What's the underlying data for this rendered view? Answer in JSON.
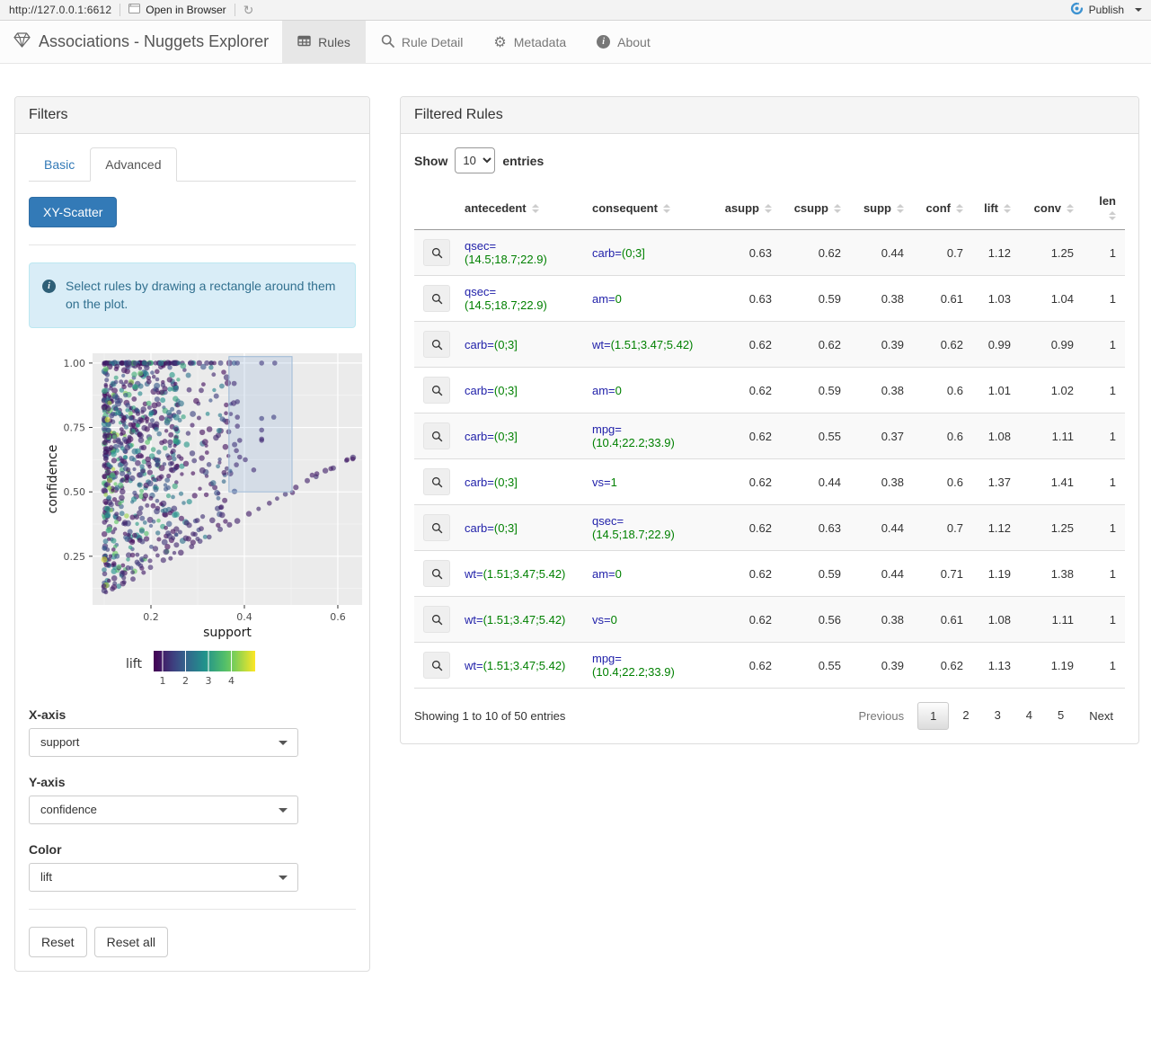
{
  "viewer_bar": {
    "url": "http://127.0.0.1:6612",
    "open_in_browser": "Open in Browser",
    "publish_label": "Publish",
    "publish_color": "#3c92d1"
  },
  "navbar": {
    "brand": "Associations - Nuggets Explorer",
    "tabs": [
      {
        "label": "Rules",
        "icon": "table-icon",
        "active": true
      },
      {
        "label": "Rule Detail",
        "icon": "search-icon",
        "active": false
      },
      {
        "label": "Metadata",
        "icon": "gear-icon",
        "active": false
      },
      {
        "label": "About",
        "icon": "info-icon",
        "active": false
      }
    ]
  },
  "filters": {
    "title": "Filters",
    "tab_basic": "Basic",
    "tab_advanced": "Advanced",
    "scatter_button": "XY-Scatter",
    "alert_text": "Select rules by drawing a rectangle around them on the plot.",
    "xaxis_label": "X-axis",
    "xaxis_value": "support",
    "yaxis_label": "Y-axis",
    "yaxis_value": "confidence",
    "color_label": "Color",
    "color_value": "lift",
    "reset_label": "Reset",
    "reset_all_label": "Reset all"
  },
  "chart_data": {
    "type": "scatter",
    "xlabel": "support",
    "ylabel": "confidence",
    "xlim": [
      0.075,
      0.652
    ],
    "ylim": [
      0.061,
      1.038
    ],
    "xticks": [
      0.2,
      0.4,
      0.6
    ],
    "yticks": [
      0.25,
      0.5,
      0.75,
      1.0
    ],
    "xminor": [
      0.1,
      0.3,
      0.5
    ],
    "yminor": [
      0.125,
      0.375,
      0.625,
      0.875
    ],
    "grid": true,
    "panel_bg": "#ebebeb",
    "color_scale": "viridis",
    "legend": {
      "label": "lift",
      "ticks": [
        "1",
        "2",
        "3",
        "4"
      ],
      "tick_fractions": [
        0.088,
        0.314,
        0.54,
        0.766
      ],
      "position": "bottom"
    },
    "selection_rect": {
      "x0": 0.367,
      "x1": 0.502,
      "y0": 0.5,
      "y1": 1.025
    },
    "points_model": {
      "seed": 7,
      "cloud_main": {
        "n": 720,
        "s_min": 0.1,
        "s_span": 0.16
      },
      "cloud_mid": {
        "n": 130,
        "s_min": 0.25,
        "s_span": 0.13
      },
      "top_row_fraction": 0.08,
      "diagonals": [
        {
          "n": 27,
          "s0": 0.1,
          "s1": 0.635,
          "slope": 1.0,
          "lift": 0.95
        },
        {
          "n": 14,
          "s0": 0.1,
          "s1": 0.35,
          "slope": 1.15,
          "lift": 1.0
        },
        {
          "n": 12,
          "s0": 0.1,
          "s1": 0.3,
          "slope": 1.3,
          "lift": 1.05
        }
      ],
      "selection_points": [
        {
          "s": 0.385,
          "c": 1.0,
          "lift": 1.3
        },
        {
          "s": 0.437,
          "c": 1.0,
          "lift": 1.2
        },
        {
          "s": 0.465,
          "c": 1.0,
          "lift": 1.2
        },
        {
          "s": 0.385,
          "c": 0.85,
          "lift": 1.1
        },
        {
          "s": 0.385,
          "c": 0.79,
          "lift": 1.0
        },
        {
          "s": 0.437,
          "c": 0.785,
          "lift": 1.3
        },
        {
          "s": 0.463,
          "c": 0.79,
          "lift": 1.3
        },
        {
          "s": 0.385,
          "c": 0.755,
          "lift": 1.0
        },
        {
          "s": 0.437,
          "c": 0.74,
          "lift": 1.1
        },
        {
          "s": 0.39,
          "c": 0.7,
          "lift": 1.0
        },
        {
          "s": 0.437,
          "c": 0.705,
          "lift": 1.0
        },
        {
          "s": 0.437,
          "c": 0.7,
          "lift": 0.95
        },
        {
          "s": 0.383,
          "c": 0.66,
          "lift": 1.0
        },
        {
          "s": 0.39,
          "c": 0.635,
          "lift": 1.0
        },
        {
          "s": 0.402,
          "c": 0.625,
          "lift": 1.0
        },
        {
          "s": 0.383,
          "c": 0.605,
          "lift": 1.0
        },
        {
          "s": 0.42,
          "c": 0.585,
          "lift": 1.0
        },
        {
          "s": 0.503,
          "c": 0.497,
          "lift": 0.95
        }
      ],
      "outliers": [
        {
          "s": 0.107,
          "c": 0.78,
          "lift": 4.8
        },
        {
          "s": 0.112,
          "c": 0.545,
          "lift": 4.4
        },
        {
          "s": 0.118,
          "c": 0.565,
          "lift": 3.6
        },
        {
          "s": 0.109,
          "c": 0.35,
          "lift": 3.2
        },
        {
          "s": 0.12,
          "c": 0.31,
          "lift": 3.0
        }
      ],
      "right_tail": [
        {
          "s": 0.545,
          "c": 0.565,
          "lift": 0.95
        },
        {
          "s": 0.555,
          "c": 0.57,
          "lift": 0.95
        },
        {
          "s": 0.585,
          "c": 0.59,
          "lift": 0.95
        },
        {
          "s": 0.62,
          "c": 0.625,
          "lift": 0.9
        },
        {
          "s": 0.632,
          "c": 0.628,
          "lift": 0.9
        }
      ]
    }
  },
  "rules_panel": {
    "title": "Filtered Rules",
    "show_label": "Show",
    "entries_label": "entries",
    "page_length": "10",
    "columns": [
      "",
      "antecedent",
      "consequent",
      "asupp",
      "csupp",
      "supp",
      "conf",
      "lift",
      "conv",
      "len"
    ],
    "rows": [
      {
        "antecedent": {
          "name": "qsec=",
          "value": "(14.5;18.7;22.9)"
        },
        "consequent": {
          "name": "carb=",
          "value": "(0;3]"
        },
        "asupp": "0.63",
        "csupp": "0.62",
        "supp": "0.44",
        "conf": "0.7",
        "lift": "1.12",
        "conv": "1.25",
        "len": "1"
      },
      {
        "antecedent": {
          "name": "qsec=",
          "value": "(14.5;18.7;22.9)"
        },
        "consequent": {
          "name": "am=",
          "value": "0"
        },
        "asupp": "0.63",
        "csupp": "0.59",
        "supp": "0.38",
        "conf": "0.61",
        "lift": "1.03",
        "conv": "1.04",
        "len": "1"
      },
      {
        "antecedent": {
          "name": "carb=",
          "value": "(0;3]"
        },
        "consequent": {
          "name": "wt=",
          "value": "(1.51;3.47;5.42)"
        },
        "asupp": "0.62",
        "csupp": "0.62",
        "supp": "0.39",
        "conf": "0.62",
        "lift": "0.99",
        "conv": "0.99",
        "len": "1"
      },
      {
        "antecedent": {
          "name": "carb=",
          "value": "(0;3]"
        },
        "consequent": {
          "name": "am=",
          "value": "0"
        },
        "asupp": "0.62",
        "csupp": "0.59",
        "supp": "0.38",
        "conf": "0.6",
        "lift": "1.01",
        "conv": "1.02",
        "len": "1"
      },
      {
        "antecedent": {
          "name": "carb=",
          "value": "(0;3]"
        },
        "consequent": {
          "name": "mpg=",
          "value": "(10.4;22.2;33.9)"
        },
        "asupp": "0.62",
        "csupp": "0.55",
        "supp": "0.37",
        "conf": "0.6",
        "lift": "1.08",
        "conv": "1.11",
        "len": "1"
      },
      {
        "antecedent": {
          "name": "carb=",
          "value": "(0;3]"
        },
        "consequent": {
          "name": "vs=",
          "value": "1"
        },
        "asupp": "0.62",
        "csupp": "0.44",
        "supp": "0.38",
        "conf": "0.6",
        "lift": "1.37",
        "conv": "1.41",
        "len": "1"
      },
      {
        "antecedent": {
          "name": "carb=",
          "value": "(0;3]"
        },
        "consequent": {
          "name": "qsec=",
          "value": "(14.5;18.7;22.9)"
        },
        "asupp": "0.62",
        "csupp": "0.63",
        "supp": "0.44",
        "conf": "0.7",
        "lift": "1.12",
        "conv": "1.25",
        "len": "1"
      },
      {
        "antecedent": {
          "name": "wt=",
          "value": "(1.51;3.47;5.42)"
        },
        "consequent": {
          "name": "am=",
          "value": "0"
        },
        "asupp": "0.62",
        "csupp": "0.59",
        "supp": "0.44",
        "conf": "0.71",
        "lift": "1.19",
        "conv": "1.38",
        "len": "1"
      },
      {
        "antecedent": {
          "name": "wt=",
          "value": "(1.51;3.47;5.42)"
        },
        "consequent": {
          "name": "vs=",
          "value": "0"
        },
        "asupp": "0.62",
        "csupp": "0.56",
        "supp": "0.38",
        "conf": "0.61",
        "lift": "1.08",
        "conv": "1.11",
        "len": "1"
      },
      {
        "antecedent": {
          "name": "wt=",
          "value": "(1.51;3.47;5.42)"
        },
        "consequent": {
          "name": "mpg=",
          "value": "(10.4;22.2;33.9)"
        },
        "asupp": "0.62",
        "csupp": "0.55",
        "supp": "0.39",
        "conf": "0.62",
        "lift": "1.13",
        "conv": "1.19",
        "len": "1"
      }
    ],
    "info": "Showing 1 to 10 of 50 entries",
    "pagination": {
      "previous": "Previous",
      "pages": [
        "1",
        "2",
        "3",
        "4",
        "5"
      ],
      "current": "1",
      "next": "Next"
    }
  }
}
